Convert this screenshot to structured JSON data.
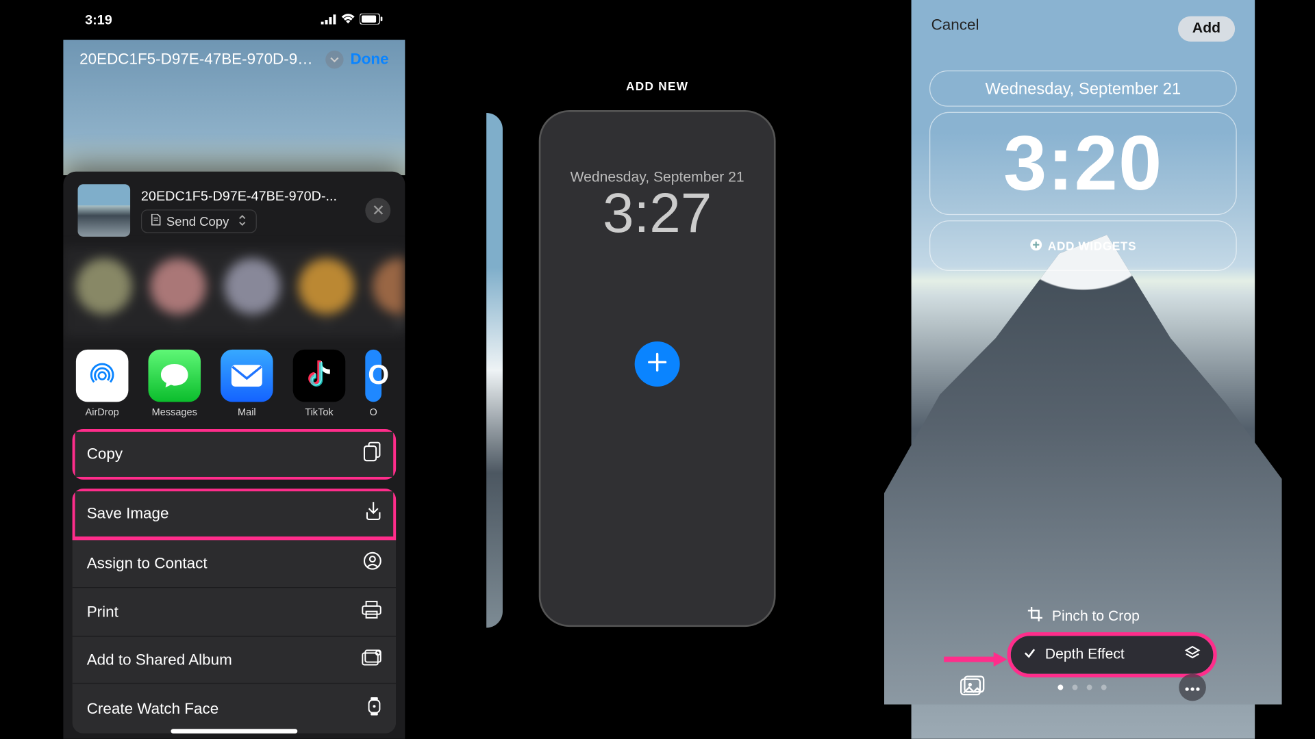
{
  "phone1": {
    "status_time": "3:19",
    "filename_header": "20EDC1F5-D97E-47BE-970D-9A...",
    "done": "Done",
    "share": {
      "filename": "20EDC1F5-D97E-47BE-970D-...",
      "send_copy": "Send Copy"
    },
    "apps": {
      "airdrop": "AirDrop",
      "messages": "Messages",
      "mail": "Mail",
      "tiktok": "TikTok",
      "other": "O"
    },
    "actions": {
      "copy": "Copy",
      "save_image": "Save Image",
      "assign_contact": "Assign to Contact",
      "print": "Print",
      "add_shared_album": "Add to Shared Album",
      "create_watch_face": "Create Watch Face"
    }
  },
  "phone2": {
    "add_new": "ADD NEW",
    "date": "Wednesday, September 21",
    "time": "3:27"
  },
  "phone3": {
    "cancel": "Cancel",
    "add": "Add",
    "date": "Wednesday, September 21",
    "time": "3:20",
    "add_widgets": "ADD WIDGETS",
    "pinch": "Pinch to Crop",
    "depth_effect": "Depth Effect"
  },
  "colors": {
    "highlight": "#ff2d8b",
    "ios_blue": "#0a84ff"
  }
}
